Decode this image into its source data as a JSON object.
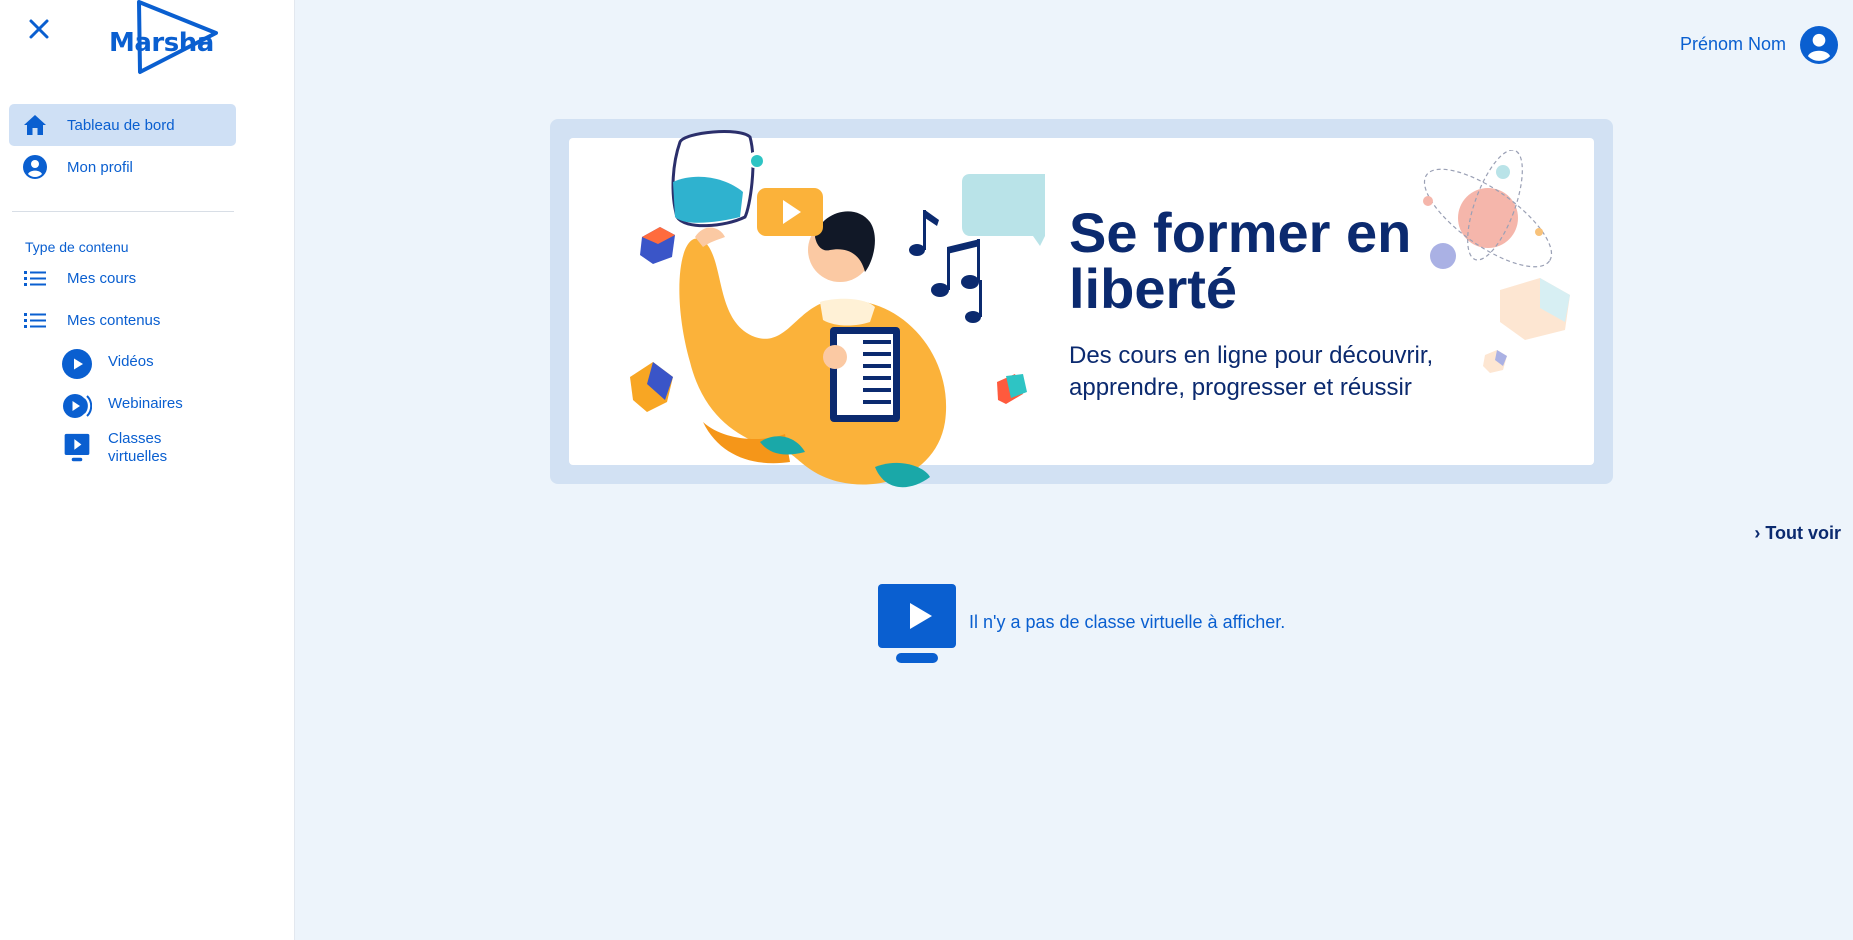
{
  "sidebar": {
    "logo_text": "Marsha",
    "items": [
      {
        "label": "Tableau de bord",
        "icon": "home-icon",
        "active": true
      },
      {
        "label": "Mon profil",
        "icon": "account-icon",
        "active": false
      }
    ],
    "section_title": "Type de contenu",
    "content_items": [
      {
        "label": "Mes cours",
        "icon": "list-icon"
      },
      {
        "label": "Mes contenus",
        "icon": "list-icon"
      }
    ],
    "sub_items": [
      {
        "label": "Vidéos",
        "icon": "play-circle-icon"
      },
      {
        "label": "Webinaires",
        "icon": "broadcast-play-icon"
      },
      {
        "label_line1": "Classes",
        "label_line2": "virtuelles",
        "icon": "monitor-play-icon"
      }
    ]
  },
  "header": {
    "user_name": "Prénom Nom"
  },
  "banner": {
    "title": "Se former en liberté",
    "subtitle": "Des cours en ligne pour découvrir, apprendre, progresser et réussir"
  },
  "main": {
    "see_all": "› Tout voir",
    "empty_message": "Il n'y a pas de classe virtuelle à afficher."
  },
  "colors": {
    "accent": "#0a5fd0",
    "dark_blue": "#0b2a6f",
    "page_bg": "#edf4fb",
    "active_bg": "#cfe0f5"
  }
}
